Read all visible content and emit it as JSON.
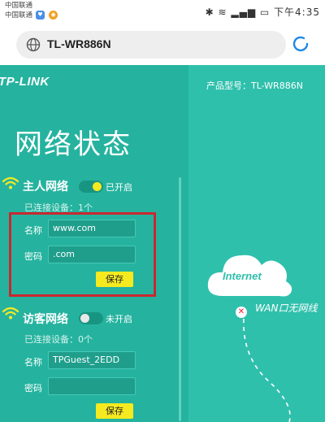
{
  "statusbar": {
    "carrier1": "中国联通",
    "carrier2": "中国联通",
    "time": "下午4:35",
    "icons": [
      "bluetooth-icon",
      "wifi-icon",
      "signal-icon",
      "signal-icon",
      "battery-icon"
    ]
  },
  "browser": {
    "url": "TL-WR886N"
  },
  "header": {
    "logo": "TP-LINK",
    "model": "产品型号：TL-WR886N"
  },
  "main": {
    "title": "网络状态"
  },
  "host_network": {
    "title": "主人网络",
    "toggle_label": "已开启",
    "toggle_on": true,
    "connected": "已连接设备：1个",
    "name_label": "名称",
    "name_value": "www.com",
    "password_label": "密码",
    "password_value": ".com",
    "save_label": "保存"
  },
  "guest_network": {
    "title": "访客网络",
    "toggle_label": "未开启",
    "toggle_on": false,
    "connected": "已连接设备：0个",
    "name_label": "名称",
    "name_value": "TPGuest_2EDD",
    "password_label": "密码",
    "password_value": "",
    "save_label": "保存"
  },
  "diagram": {
    "internet_label": "Internet",
    "wan_status": "WAN口无网线"
  },
  "colors": {
    "accent": "#2fc0ac",
    "panel": "#25b39f",
    "save_button": "#f5ea20",
    "highlight_box": "#c9282f"
  }
}
